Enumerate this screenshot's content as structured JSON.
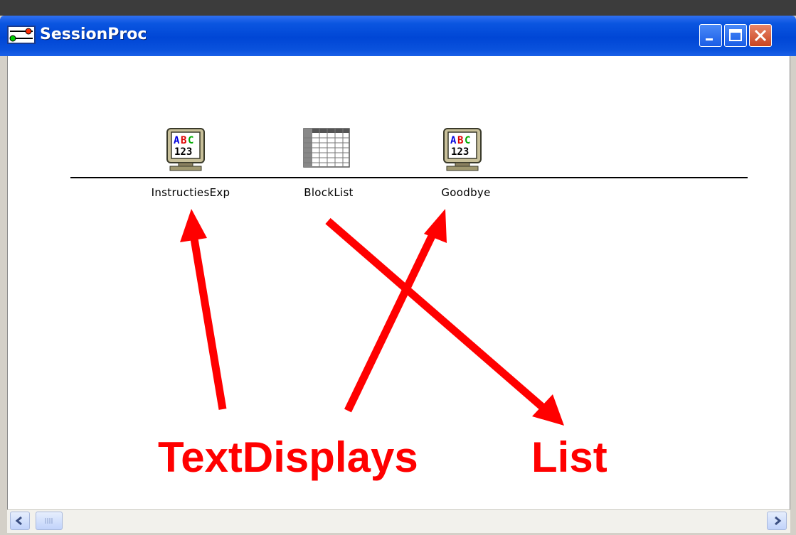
{
  "window": {
    "title": "SessionProc",
    "icon": "procedure-icon",
    "controls": [
      "minimize",
      "maximize",
      "close"
    ]
  },
  "timeline": {
    "start_color": "#00ff00",
    "end_color": "#ff0000",
    "nodes": [
      {
        "label": "InstructiesExp",
        "icon": "text-display-icon"
      },
      {
        "label": "BlockList",
        "icon": "list-icon"
      },
      {
        "label": "Goodbye",
        "icon": "text-display-icon"
      }
    ]
  },
  "annotations": {
    "left": "TextDisplays",
    "right": "List",
    "color": "#ff0000"
  },
  "scrollbar": {
    "left_arrow": "<",
    "right_arrow": ">"
  }
}
